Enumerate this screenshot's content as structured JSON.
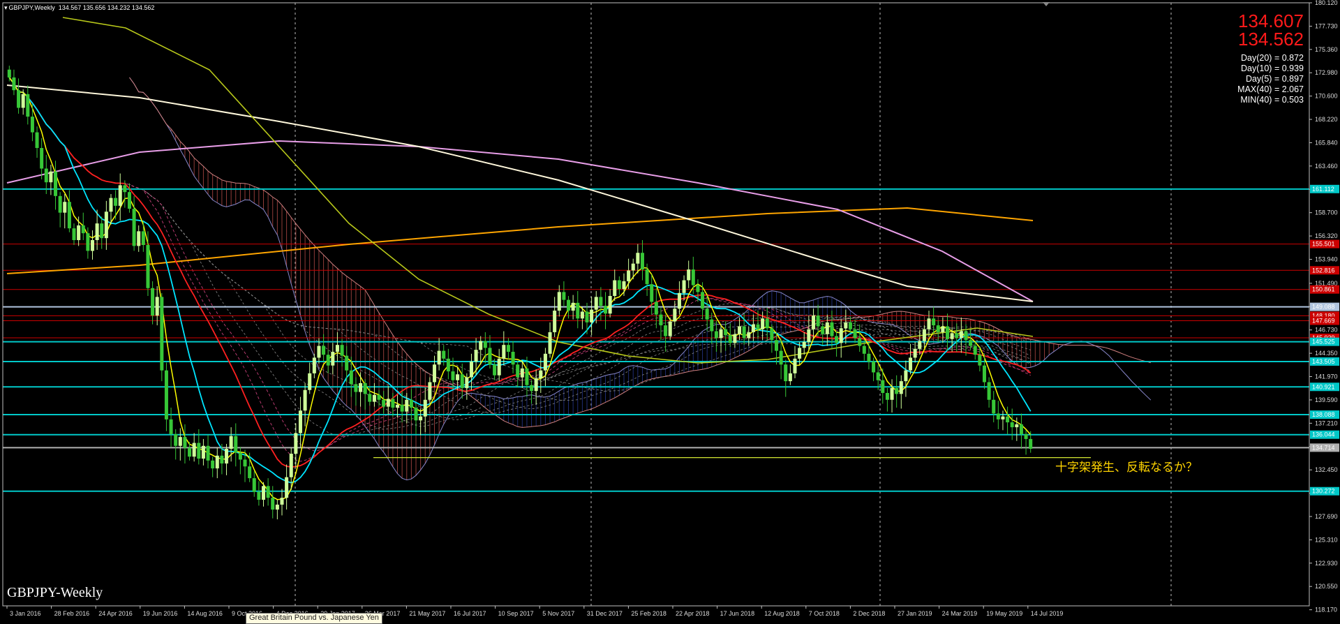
{
  "window": {
    "symbol_header": "GBPJPY,Weekly",
    "ohlc": "134.567 135.656 134.232 134.562",
    "symbol_label": "GBPJPY-Weekly",
    "tooltip": "Great Britain Pound vs. Japanese Yen"
  },
  "prices": {
    "ask": "134.607",
    "bid": "134.562"
  },
  "stats": [
    "Day(20) = 0.872",
    "Day(10) = 0.939",
    "Day(5) = 0.897",
    "MAX(40) = 2.067",
    "MIN(40) = 0.503"
  ],
  "annotation": "十字架発生、反転なるか？",
  "colors": {
    "background": "#000000",
    "axis": "#c0c0c0",
    "bull_candle": "#cfff9a",
    "bear_candle": "#37c737",
    "cyan_line": "#00e5ff",
    "red_line": "#ff2020",
    "yellow_line": "#ffff00",
    "orange_line": "#ffa500",
    "pink_line": "#e89ee8",
    "white_line": "#fff8dc",
    "olive_line": "#b8c81a"
  },
  "chart_data": {
    "type": "candlestick",
    "title": "GBPJPY,Weekly",
    "ylim": [
      118.57,
      180.12
    ],
    "y_ticks": [
      "180.120",
      "177.730",
      "175.360",
      "172.980",
      "170.600",
      "168.220",
      "165.840",
      "163.460",
      "161.080",
      "158.700",
      "156.320",
      "153.940",
      "151.490",
      "149.110",
      "146.730",
      "144.350",
      "141.970",
      "139.590",
      "137.210",
      "134.830",
      "132.450",
      "130.070",
      "127.690",
      "125.310",
      "122.930",
      "120.550",
      "118.170"
    ],
    "x_ticks": [
      "3 Jan 2016",
      "28 Feb 2016",
      "24 Apr 2016",
      "19 Jun 2016",
      "14 Aug 2016",
      "9 Oct 2016",
      "4 Dec 2016",
      "29 Jan 2017",
      "26 Mar 2017",
      "21 May 2017",
      "16 Jul 2017",
      "10 Sep 2017",
      "5 Nov 2017",
      "31 Dec 2017",
      "25 Feb 2018",
      "22 Apr 2018",
      "17 Jun 2018",
      "12 Aug 2018",
      "7 Oct 2018",
      "2 Dec 2018",
      "27 Jan 2019",
      "24 Mar 2019",
      "19 May 2019",
      "14 Jul 2019"
    ],
    "price_levels": [
      {
        "label": "161.112",
        "value": 161.112,
        "color": "#00c8c8"
      },
      {
        "label": "155.501",
        "value": 155.501,
        "color": "#cc0000"
      },
      {
        "label": "152.816",
        "value": 152.816,
        "color": "#cc0000"
      },
      {
        "label": "150.861",
        "value": 150.861,
        "color": "#cc0000"
      },
      {
        "label": "149.088",
        "value": 149.088,
        "color": "#b0c4de"
      },
      {
        "label": "148.180",
        "value": 148.18,
        "color": "#cc0000"
      },
      {
        "label": "147.669",
        "value": 147.669,
        "color": "#cc0000"
      },
      {
        "label": "145.929",
        "value": 145.929,
        "color": "#cc0000"
      },
      {
        "label": "145.525",
        "value": 145.525,
        "color": "#00c8c8"
      },
      {
        "label": "143.505",
        "value": 143.505,
        "color": "#00c8c8"
      },
      {
        "label": "140.921",
        "value": 140.921,
        "color": "#00c8c8"
      },
      {
        "label": "138.088",
        "value": 138.088,
        "color": "#00c8c8"
      },
      {
        "label": "136.044",
        "value": 136.044,
        "color": "#00c8c8"
      },
      {
        "label": "134.714",
        "value": 134.714,
        "color": "#b0b0b0"
      },
      {
        "label": "130.272",
        "value": 130.272,
        "color": "#00c8c8"
      }
    ],
    "support_line": 133.7,
    "closes": [
      172.5,
      171.2,
      169.4,
      170.8,
      168.5,
      166.9,
      165.3,
      163.2,
      161.8,
      162.9,
      160.4,
      158.7,
      159.8,
      157.1,
      155.9,
      157.4,
      156.6,
      154.8,
      155.9,
      157.6,
      156.1,
      158.8,
      160.2,
      159.4,
      161.5,
      160.8,
      159.1,
      155.3,
      156.8,
      155.4,
      151.0,
      148.2,
      150.1,
      142.6,
      137.6,
      136.1,
      134.9,
      135.8,
      134.7,
      133.8,
      135.2,
      133.6,
      134.9,
      133.4,
      132.6,
      133.9,
      133.1,
      134.6,
      135.9,
      134.2,
      133.5,
      132.8,
      131.6,
      130.2,
      129.4,
      130.8,
      129.6,
      128.4,
      128.9,
      129.6,
      131.7,
      134.1,
      136.2,
      138.5,
      140.6,
      142.3,
      143.9,
      145.1,
      144.2,
      143.1,
      144.5,
      145.2,
      144.1,
      142.6,
      141.2,
      140.4,
      141.3,
      140.2,
      139.4,
      140.1,
      139.6,
      138.9,
      139.7,
      138.8,
      139.1,
      138.4,
      139.6,
      138.8,
      137.5,
      137.9,
      139.6,
      141.4,
      143.2,
      144.6,
      143.8,
      142.5,
      141.6,
      142.2,
      140.8,
      141.9,
      143.5,
      144.7,
      145.6,
      144.9,
      143.2,
      142.1,
      143.8,
      145.2,
      144.5,
      143.2,
      141.9,
      142.8,
      141.1,
      140.5,
      141.8,
      142.6,
      144.3,
      146.5,
      148.7,
      150.6,
      149.8,
      148.7,
      149.5,
      147.9,
      148.6,
      147.5,
      148.8,
      150.1,
      149.2,
      148.4,
      150.2,
      151.8,
      150.9,
      151.7,
      152.8,
      153.5,
      154.6,
      152.9,
      151.4,
      149.6,
      148.3,
      147.2,
      146.1,
      147.6,
      148.9,
      150.5,
      151.8,
      152.9,
      151.3,
      150.6,
      148.9,
      147.8,
      146.6,
      145.9,
      146.8,
      146.2,
      145.4,
      146.3,
      147.1,
      145.9,
      146.5,
      147.3,
      146.8,
      147.9,
      146.9,
      145.7,
      144.6,
      143.2,
      141.5,
      142.3,
      143.8,
      144.9,
      145.5,
      146.8,
      148.2,
      147.1,
      146.3,
      147.5,
      146.1,
      145.4,
      146.9,
      147.5,
      146.8,
      145.9,
      145.1,
      144.3,
      143.5,
      142.4,
      141.6,
      140.3,
      139.6,
      140.8,
      140.2,
      141.5,
      142.6,
      143.9,
      144.8,
      145.6,
      146.8,
      147.9,
      147.2,
      146.5,
      147.1,
      145.8,
      146.4,
      145.9,
      146.6,
      145.7,
      145.1,
      144.2,
      143.1,
      141.4,
      139.6,
      138.2,
      137.6,
      137.9,
      137.3,
      136.8,
      137.1,
      136.1,
      135.6,
      134.6
    ]
  }
}
